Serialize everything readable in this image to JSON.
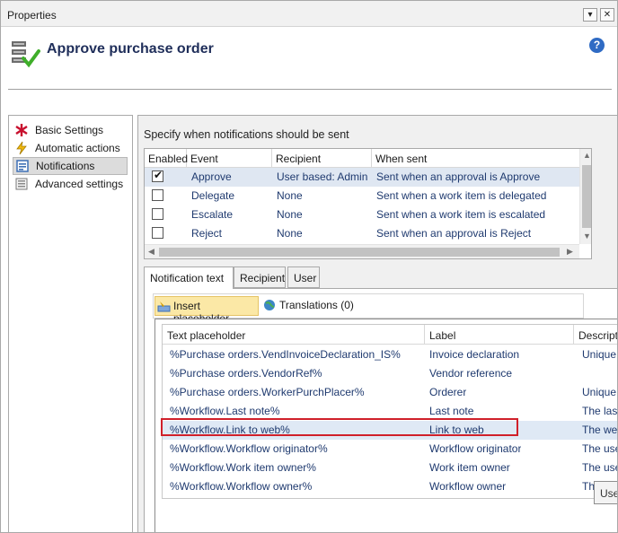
{
  "window": {
    "title": "Properties",
    "min_glyph": "▾",
    "close_glyph": "✕"
  },
  "header": {
    "title": "Approve purchase order",
    "help_glyph": "?",
    "icon": "workflow-approval-icon"
  },
  "nav": {
    "items": [
      {
        "label": "Basic Settings",
        "icon": "asterisk-icon",
        "selected": false
      },
      {
        "label": "Automatic actions",
        "icon": "lightning-icon",
        "selected": false
      },
      {
        "label": "Notifications",
        "icon": "notification-icon",
        "selected": true
      },
      {
        "label": "Advanced settings",
        "icon": "settings-list-icon",
        "selected": false
      }
    ]
  },
  "notifications": {
    "heading": "Specify when notifications should be sent",
    "columns": [
      "Enabled",
      "Event",
      "Recipient",
      "When sent"
    ],
    "rows": [
      {
        "enabled": true,
        "event": "Approve",
        "recipient": "User based: Admin",
        "when": "Sent when an approval is Approve"
      },
      {
        "enabled": false,
        "event": "Delegate",
        "recipient": "None",
        "when": "Sent when a work item is delegated"
      },
      {
        "enabled": false,
        "event": "Escalate",
        "recipient": "None",
        "when": "Sent when a work item is escalated"
      },
      {
        "enabled": false,
        "event": "Reject",
        "recipient": "None",
        "when": "Sent when an approval is Reject"
      }
    ]
  },
  "tabs": [
    {
      "label": "Notification text",
      "active": true
    },
    {
      "label": "Recipient",
      "active": false
    },
    {
      "label": "User",
      "active": false
    }
  ],
  "toolbar": {
    "insert_placeholder": "Insert placeholder",
    "translations": "Translations (0)"
  },
  "placeholders": {
    "columns": [
      "Text placeholder",
      "Label",
      "Descriptio"
    ],
    "rows": [
      {
        "text": "%Purchase orders.VendInvoiceDeclaration_IS%",
        "label": "Invoice declaration",
        "desc": "Unique"
      },
      {
        "text": "%Purchase orders.VendorRef%",
        "label": "Vendor reference",
        "desc": ""
      },
      {
        "text": "%Purchase orders.WorkerPurchPlacer%",
        "label": "Orderer",
        "desc": "Unique"
      },
      {
        "text": "%Workflow.Last note%",
        "label": "Last note",
        "desc": "The last"
      },
      {
        "text": "%Workflow.Link to web%",
        "label": "Link to web",
        "desc": "The web"
      },
      {
        "text": "%Workflow.Workflow originator%",
        "label": "Workflow originator",
        "desc": "The user"
      },
      {
        "text": "%Workflow.Work item owner%",
        "label": "Work item owner",
        "desc": "The user"
      },
      {
        "text": "%Workflow.Workflow owner%",
        "label": "Workflow owner",
        "desc": "The"
      }
    ],
    "selected_index": 4
  },
  "tooltip": "Use"
}
